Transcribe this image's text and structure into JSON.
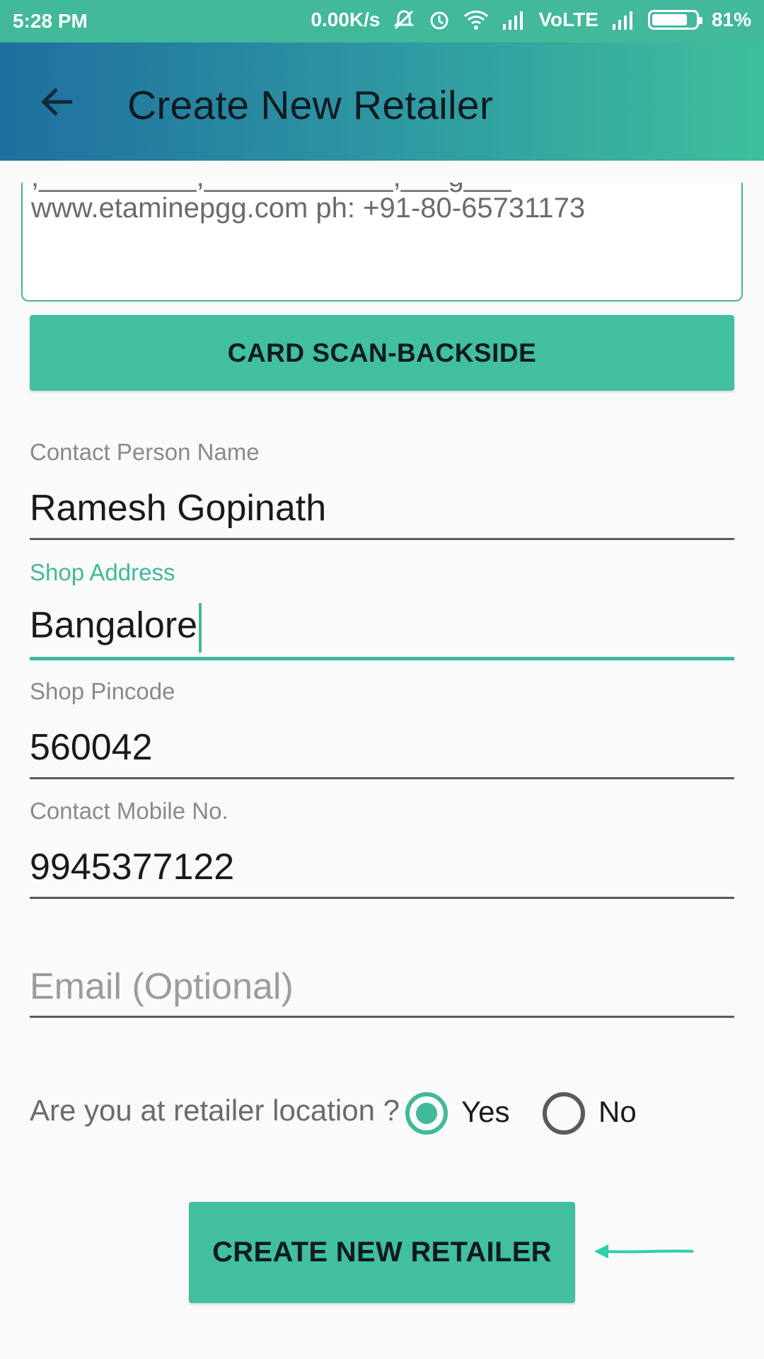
{
  "status_bar": {
    "time": "5:28 PM",
    "network_speed": "0.00K/s",
    "network_type": "VoLTE",
    "battery_percent": "81%",
    "battery_level": 0.81,
    "icons": [
      "mute-icon",
      "alarm-icon",
      "wifi-icon",
      "signal-icon",
      "signal-icon",
      "battery-icon"
    ]
  },
  "app_bar": {
    "title": "Create New Retailer",
    "back_icon": "arrow-back-icon"
  },
  "card_text": {
    "visible_text": "www.etaminepgg.com ph: +91-80-65731173"
  },
  "buttons": {
    "card_scan_back": "CARD SCAN-BACKSIDE",
    "create_retailer": "CREATE NEW RETAILER"
  },
  "form": {
    "contact_person": {
      "label": "Contact Person Name",
      "value": "Ramesh Gopinath"
    },
    "shop_address": {
      "label": "Shop Address",
      "value": "Bangalore"
    },
    "shop_pincode": {
      "label": "Shop Pincode",
      "value": "560042"
    },
    "contact_mobile": {
      "label": "Contact Mobile No.",
      "value": "9945377122"
    },
    "email": {
      "placeholder": "Email (Optional)"
    }
  },
  "location_question": {
    "text": "Are you at retailer location ?",
    "options": [
      {
        "label": "Yes",
        "selected": true
      },
      {
        "label": "No",
        "selected": false
      }
    ]
  },
  "colors": {
    "accent": "#41b99a",
    "appbar_start": "#1f6f9f",
    "appbar_end": "#3fbf9c"
  }
}
